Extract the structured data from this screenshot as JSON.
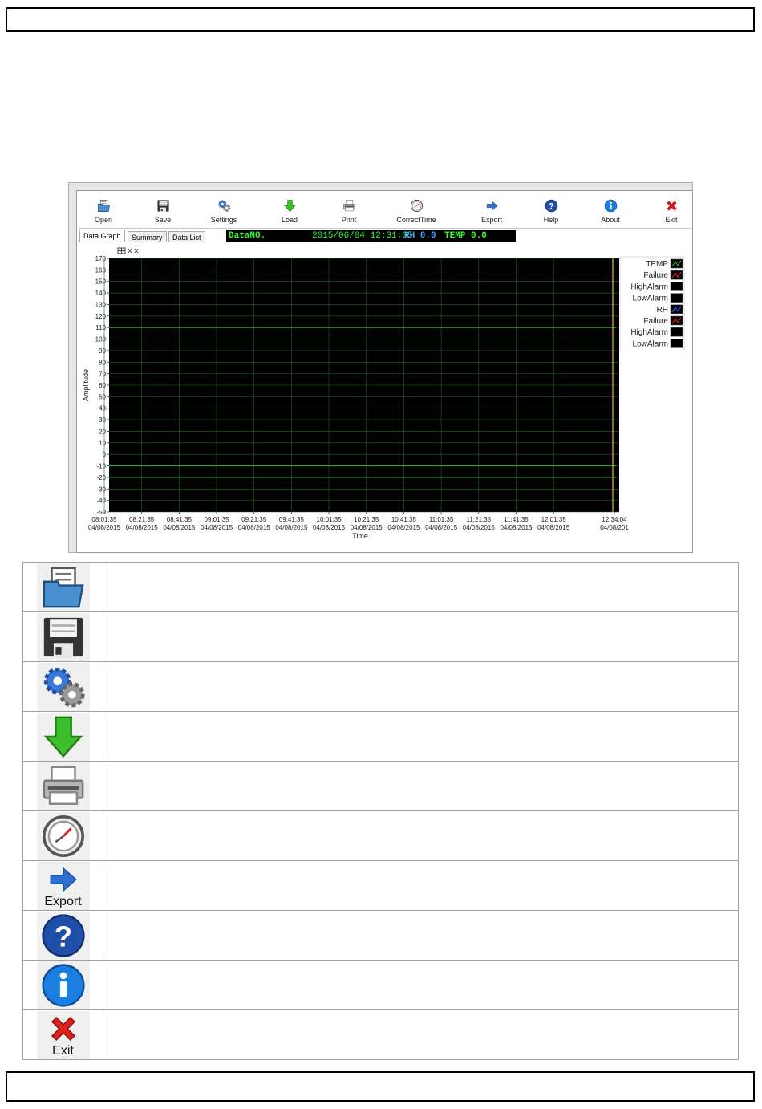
{
  "toolbar": {
    "buttons": [
      {
        "label": "Open",
        "icon": "open-icon"
      },
      {
        "label": "Save",
        "icon": "save-icon"
      },
      {
        "label": "Settings",
        "icon": "settings-icon"
      },
      {
        "label": "Load",
        "icon": "load-icon"
      },
      {
        "label": "Print",
        "icon": "print-icon"
      },
      {
        "label": "CorrectTime",
        "icon": "clock-icon"
      },
      {
        "label": "Export",
        "icon": "export-icon"
      },
      {
        "label": "Help",
        "icon": "help-icon"
      },
      {
        "label": "About",
        "icon": "about-icon"
      },
      {
        "label": "Exit",
        "icon": "exit-icon"
      }
    ]
  },
  "tabs": [
    "Data Graph",
    "Summary",
    "Data List"
  ],
  "status": {
    "data_no": "DataNO.",
    "datetime": "2015/06/04 12:31:05",
    "rh": "RH 0.0",
    "temp": "TEMP 0.0"
  },
  "chart_data": {
    "type": "line",
    "ylabel": "Amplitude",
    "xlabel": "Time",
    "ylim": [
      -50,
      170
    ],
    "yticks": [
      170,
      160,
      150,
      140,
      130,
      120,
      110,
      100,
      90,
      80,
      70,
      60,
      50,
      40,
      30,
      20,
      10,
      0,
      -10,
      -20,
      -30,
      -40,
      -50
    ],
    "ytick_labels": [
      "170",
      "160",
      "150",
      "140",
      "130",
      "120",
      "110",
      "100",
      "90",
      "80",
      "70",
      "60",
      "50",
      "40",
      "30",
      "20",
      "10",
      "0",
      "-10",
      "-20",
      "-30",
      "-40",
      "-50"
    ],
    "xtick_times": [
      "08:01:35",
      "08:21:35",
      "08:41:35",
      "09:01:35",
      "09:21:35",
      "09:41:35",
      "10:01:35",
      "10:21:35",
      "10:41:35",
      "11:01:35",
      "11:21:35",
      "11:41:35",
      "12:01:35",
      "12:34:04"
    ],
    "xtick_dates": [
      "04/08/2015",
      "04/08/2015",
      "04/08/2015",
      "04/08/2015",
      "04/08/2015",
      "04/08/2015",
      "04/08/2015",
      "04/08/2015",
      "04/08/2015",
      "04/08/2015",
      "04/08/2015",
      "04/08/2015",
      "04/08/2015",
      "04/08/201"
    ],
    "xtick_minutes_from_first": [
      0,
      20,
      40,
      60,
      80,
      100,
      120,
      140,
      160,
      180,
      200,
      220,
      240,
      272.5
    ],
    "reference_lines": [
      110,
      -10,
      -20
    ],
    "background": "#000000",
    "grid_color": "#1f6b1f",
    "legend": [
      {
        "name": "TEMP",
        "color": "#2ecc2e"
      },
      {
        "name": "Failure",
        "color": "#ff2020"
      },
      {
        "name": "HighAlarm",
        "color": "#000000"
      },
      {
        "name": "LowAlarm",
        "color": "#000000"
      },
      {
        "name": "RH",
        "color": "#3a66ff"
      },
      {
        "name": "Failure",
        "color": "#ff2020"
      },
      {
        "name": "HighAlarm",
        "color": "#000000"
      },
      {
        "name": "LowAlarm",
        "color": "#000000"
      }
    ],
    "legend_position": "top-right"
  },
  "descriptions": {
    "rows": [
      {
        "icon": "open-icon",
        "caption": ""
      },
      {
        "icon": "save-icon",
        "caption": ""
      },
      {
        "icon": "settings-icon",
        "caption": ""
      },
      {
        "icon": "load-icon",
        "caption": ""
      },
      {
        "icon": "print-icon",
        "caption": ""
      },
      {
        "icon": "clock-icon",
        "caption": ""
      },
      {
        "icon": "export-icon",
        "caption": "Export"
      },
      {
        "icon": "help-icon",
        "caption": ""
      },
      {
        "icon": "about-icon",
        "caption": ""
      },
      {
        "icon": "exit-icon",
        "caption": "Exit"
      }
    ]
  }
}
